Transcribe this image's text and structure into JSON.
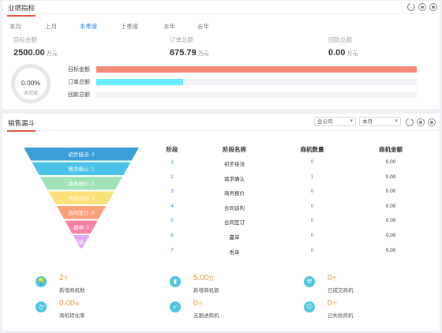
{
  "performance": {
    "title": "业绩指标",
    "tabs": [
      "本月",
      "上月",
      "本季度",
      "上季度",
      "本年",
      "去年"
    ],
    "active_tab": 2,
    "kpis": [
      {
        "label": "目标金额",
        "value": "2500.00",
        "unit": "万元"
      },
      {
        "label": "订单总额",
        "value": "675.79",
        "unit": "万元"
      },
      {
        "label": "回款总额",
        "value": "0.00",
        "unit": "万元"
      }
    ],
    "ring": {
      "percent": "0.00%",
      "label": "未完成"
    },
    "bars": [
      {
        "label": "目标金额",
        "fraction": 1.0,
        "color": "#f58a78"
      },
      {
        "label": "订单总额",
        "fraction": 0.27,
        "color": "#65eefa"
      },
      {
        "label": "回款总额",
        "fraction": 0.0,
        "color": "#f58a78"
      }
    ]
  },
  "funnel": {
    "title": "销售漏斗",
    "filter_company": "全公司",
    "filter_period": "本月",
    "headers": [
      "阶段",
      "阶段名称",
      "商机数量",
      "商机金额"
    ],
    "rows": [
      {
        "stage": "1",
        "name": "初步接洽",
        "count": "0",
        "amount": "0.00"
      },
      {
        "stage": "2",
        "name": "需求确认",
        "count": "1",
        "amount": "0.00"
      },
      {
        "stage": "3",
        "name": "商务报价",
        "count": "0",
        "amount": "0.00"
      },
      {
        "stage": "4",
        "name": "合同谈判",
        "count": "0",
        "amount": "0.00"
      },
      {
        "stage": "5",
        "name": "合同签订",
        "count": "0",
        "amount": "0.00"
      },
      {
        "stage": "6",
        "name": "赢单",
        "count": "0",
        "amount": "0.00"
      },
      {
        "stage": "7",
        "name": "丢单",
        "count": "0",
        "amount": "0.00"
      }
    ],
    "segments": [
      {
        "label": "初步接洽: 0",
        "color": "#3a9fd8"
      },
      {
        "label": "需求确认: 1",
        "color": "#49c3e8"
      },
      {
        "label": "商务报价: 0",
        "color": "#a0e3b7"
      },
      {
        "label": "合同谈判: 0",
        "color": "#fde07a"
      },
      {
        "label": "合同签订: 0",
        "color": "#fca07c"
      },
      {
        "label": "赢单: 0",
        "color": "#f982a4"
      },
      {
        "label": "丢单: 0",
        "color": "#e0a8f3"
      }
    ],
    "stats": [
      {
        "icon": "lightbulb-icon",
        "glyph": "💡",
        "value": "2",
        "unit": "个",
        "label": "新增商机数"
      },
      {
        "icon": "bar-chart-icon",
        "glyph": "▮",
        "value": "5.00",
        "unit": "万",
        "label": "新增商机额"
      },
      {
        "icon": "hammer-icon",
        "glyph": "⚒",
        "value": "0",
        "unit": "个",
        "label": "已成交商机"
      },
      {
        "icon": "clock-icon",
        "glyph": "◷",
        "value": "0.00",
        "unit": "%",
        "label": "商机转化率"
      },
      {
        "icon": "runner-icon",
        "glyph": "➶",
        "value": "0",
        "unit": "个",
        "label": "无跟进商机"
      },
      {
        "icon": "lost-icon",
        "glyph": "☹",
        "value": "0",
        "unit": "个",
        "label": "已失败商机"
      }
    ]
  }
}
